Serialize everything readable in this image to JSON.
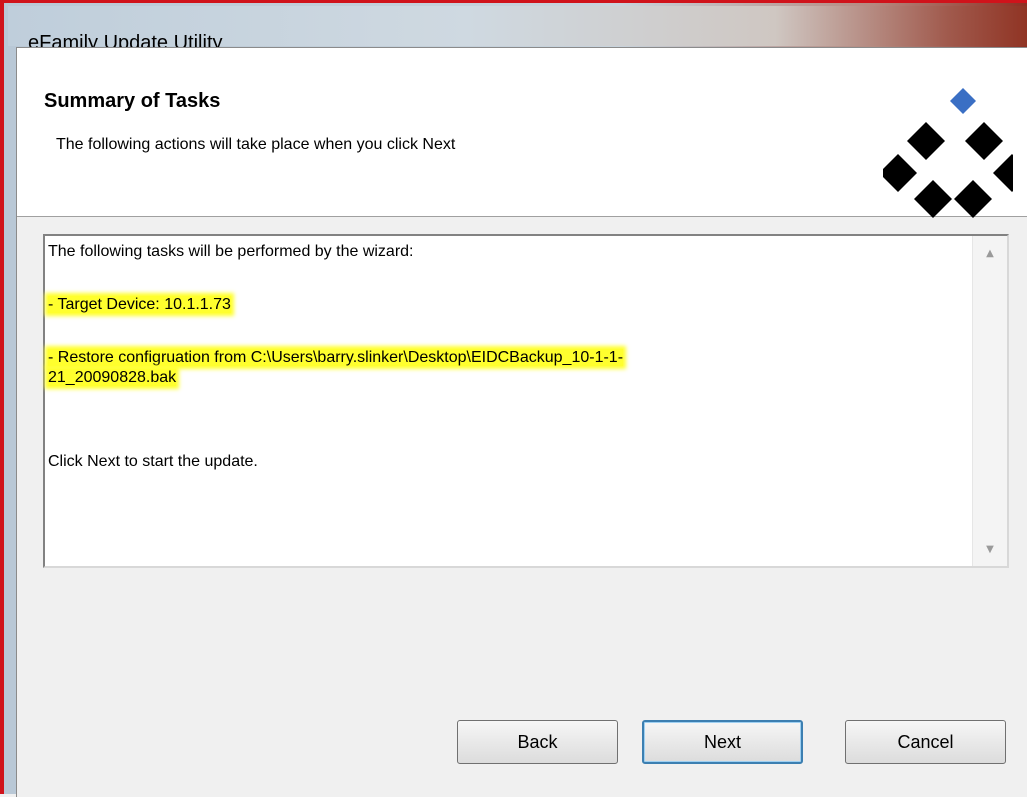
{
  "window": {
    "title": "eFamily Update Utility"
  },
  "header": {
    "title": "Summary of Tasks",
    "subtitle": "The following actions will take place when you click Next"
  },
  "summary": {
    "intro": "The following tasks will be performed by the wizard:",
    "target_device": "- Target Device: 10.1.1.73",
    "restore_line1": "- Restore configruation from C:\\Users\\barry.slinker\\Desktop\\EIDCBackup_10-1-1-",
    "restore_line2": "21_20090828.bak",
    "footer": "Click Next to start the update."
  },
  "buttons": {
    "back": "Back",
    "next": "Next",
    "cancel": "Cancel"
  },
  "colors": {
    "highlight": "#ffff2e",
    "logo_accent": "#3a6fc4",
    "frame_red": "#d0131b"
  },
  "icons": {
    "scroll_up": "scroll-up-arrow-icon",
    "scroll_down": "scroll-down-arrow-icon",
    "logo": "diamond-logo-icon"
  }
}
